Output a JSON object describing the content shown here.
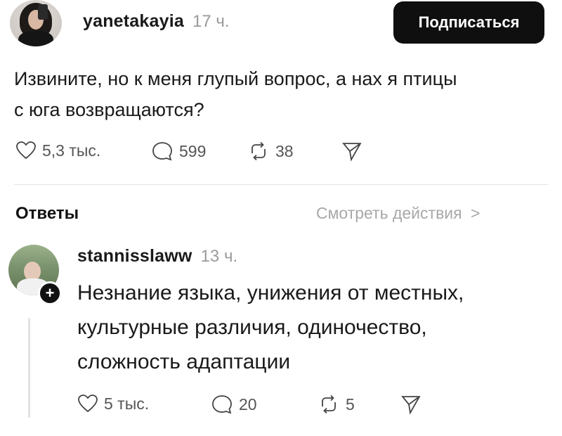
{
  "post": {
    "username": "yanetakayia",
    "time": "17 ч.",
    "follow_label": "Подписаться",
    "text_line1": "Извините, но к меня глупый вопрос, а нах  я птицы",
    "text_line2": "с юга возвращаются?",
    "likes": "5,3 тыс.",
    "comments": "599",
    "reposts": "38"
  },
  "replies_section": {
    "title": "Ответы",
    "view_actions_label": "Смотреть действия",
    "chevron": ">"
  },
  "reply": {
    "username": "stannisslaww",
    "time": "13 ч.",
    "plus": "+",
    "text_line1": "Незнание языка, унижения от местных,",
    "text_line2": "культурные различия, одиночество,",
    "text_line3": "сложность адаптации",
    "likes": "5 тыс.",
    "comments": "20",
    "reposts": "5"
  },
  "icons": {
    "like": "heart-icon",
    "comment": "comment-bubble-icon",
    "repost": "repost-icon",
    "share": "send-icon",
    "plus": "plus-icon",
    "chevron": "chevron-right-icon"
  }
}
